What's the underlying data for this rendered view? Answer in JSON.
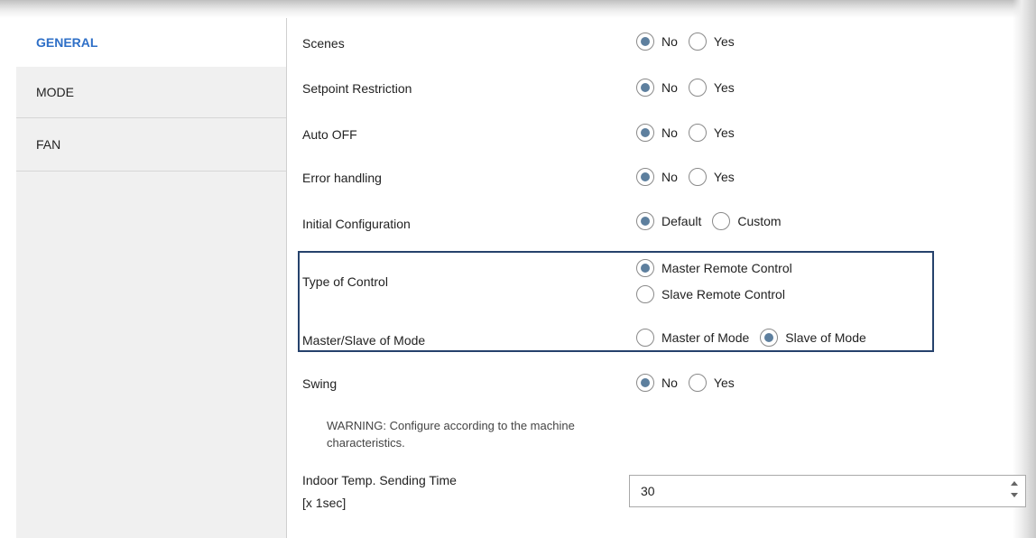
{
  "sidebar": {
    "items": [
      {
        "label": "GENERAL"
      },
      {
        "label": "MODE"
      },
      {
        "label": "FAN"
      }
    ]
  },
  "params": {
    "scenes": {
      "label": "Scenes",
      "options": [
        "No",
        "Yes"
      ],
      "selected": "No"
    },
    "setpoint_restriction": {
      "label": "Setpoint Restriction",
      "options": [
        "No",
        "Yes"
      ],
      "selected": "No"
    },
    "auto_off": {
      "label": "Auto OFF",
      "options": [
        "No",
        "Yes"
      ],
      "selected": "No"
    },
    "error_handling": {
      "label": "Error handling",
      "options": [
        "No",
        "Yes"
      ],
      "selected": "No"
    },
    "initial_configuration": {
      "label": "Initial Configuration",
      "options": [
        "Default",
        "Custom"
      ],
      "selected": "Default"
    },
    "type_of_control": {
      "label": "Type of Control",
      "options": [
        "Master Remote Control",
        "Slave Remote Control"
      ],
      "selected": "Master Remote Control"
    },
    "master_slave_of_mode": {
      "label": "Master/Slave of Mode",
      "options": [
        "Master of Mode",
        "Slave of Mode"
      ],
      "selected": "Slave of Mode"
    },
    "swing": {
      "label": "Swing",
      "options": [
        "No",
        "Yes"
      ],
      "selected": "No"
    },
    "warning": "WARNING: Configure according to the machine characteristics.",
    "indoor_temp_sending_time": {
      "label_line1": "Indoor Temp. Sending Time",
      "label_line2": "[x 1sec]",
      "value": "30"
    }
  },
  "colors": {
    "accent": "#2e6fc7",
    "highlight_border": "#26426c",
    "radio_dot": "#5d7f9e"
  }
}
